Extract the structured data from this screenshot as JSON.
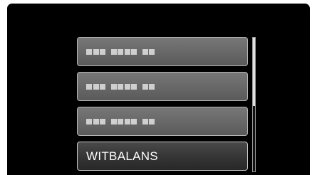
{
  "menu": {
    "items": [
      {
        "label": "",
        "placeholder_blocks": [
          3,
          4,
          2
        ]
      },
      {
        "label": "",
        "placeholder_blocks": [
          3,
          4,
          2
        ]
      },
      {
        "label": "",
        "placeholder_blocks": [
          3,
          4,
          2
        ]
      },
      {
        "label": "WITBALANS"
      }
    ],
    "scroll_position": 0.5
  }
}
